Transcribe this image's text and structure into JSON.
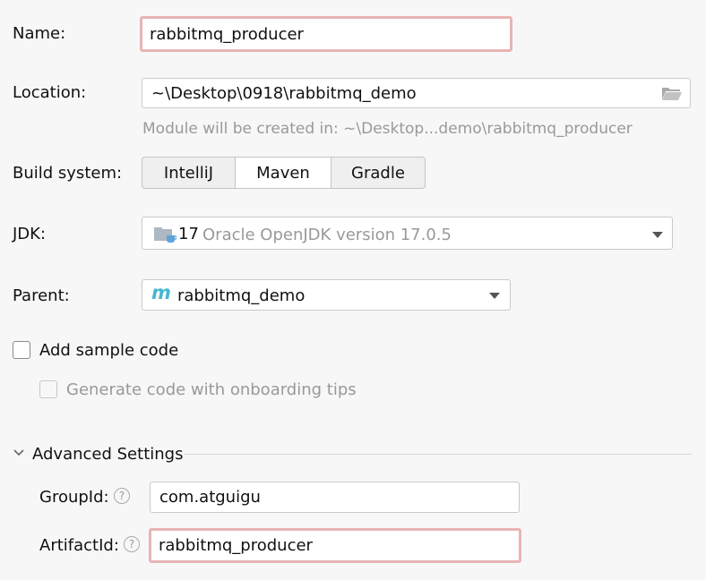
{
  "name": {
    "label": "Name:",
    "value": "rabbitmq_producer"
  },
  "location": {
    "label": "Location:",
    "value": "~\\Desktop\\0918\\rabbitmq_demo",
    "hint": "Module will be created in: ~\\Desktop...demo\\rabbitmq_producer"
  },
  "build_system": {
    "label": "Build system:",
    "options": [
      "IntelliJ",
      "Maven",
      "Gradle"
    ],
    "selected": "Maven"
  },
  "jdk": {
    "label": "JDK:",
    "version": "17",
    "description": "Oracle OpenJDK version 17.0.5"
  },
  "parent": {
    "label": "Parent:",
    "value": "rabbitmq_demo",
    "icon": "maven-m-icon"
  },
  "sample_code": {
    "label": "Add sample code",
    "checked": false
  },
  "onboarding": {
    "label": "Generate code with onboarding tips",
    "checked": false,
    "disabled": true
  },
  "advanced": {
    "title": "Advanced Settings",
    "expanded": true,
    "group_id": {
      "label": "GroupId:",
      "value": "com.atguigu"
    },
    "artifact_id": {
      "label": "ArtifactId:",
      "value": "rabbitmq_producer"
    }
  },
  "colors": {
    "error_border": "#e8b4b4",
    "hint": "#999999",
    "maven_icon": "#45b7d1"
  }
}
